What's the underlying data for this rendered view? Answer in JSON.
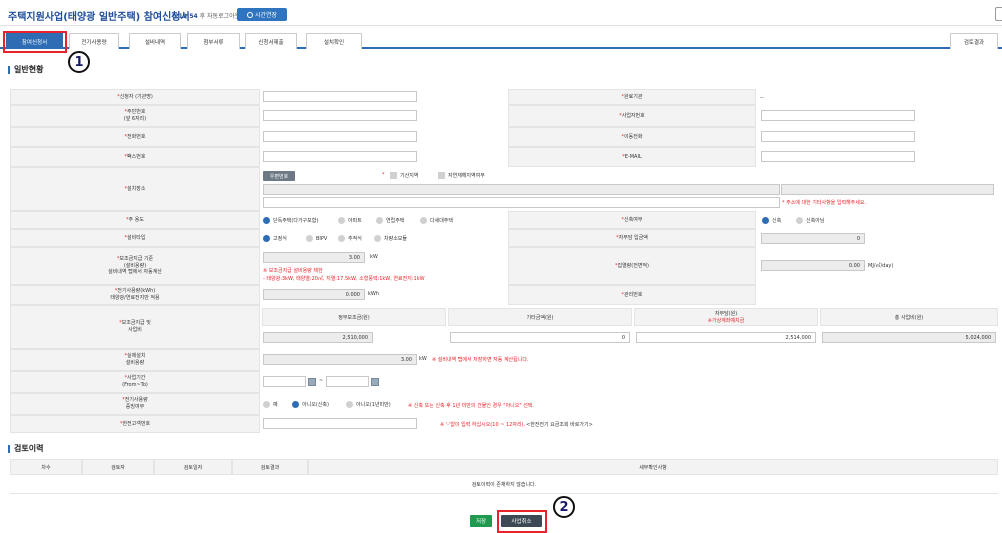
{
  "header": {
    "title": "주택지원사업(태양광 일반주택) 참여신청서",
    "timer_value": "0:19:54",
    "timer_suffix": "후 자동로그아웃",
    "extend_label": "시간연장"
  },
  "tabs": [
    {
      "label": "참여신청서",
      "active": true
    },
    {
      "label": "전기사용량"
    },
    {
      "label": "설비내역"
    },
    {
      "label": "첨부서류"
    },
    {
      "label": "신청서제출"
    },
    {
      "label": "설치확인"
    }
  ],
  "review_tab": "검토결과",
  "markers": {
    "one": "1",
    "two": "2"
  },
  "section_general": "일반현황",
  "section_history": "검토이력",
  "form": {
    "applicant_label": "신청자 (기관명)",
    "agency_label": "완료기관",
    "agency_value": "--",
    "id_label": "주민번호\n(앞 6자리)",
    "bizno_label": "사업자번호",
    "phone_label": "전화번호",
    "mobile_label": "이동전화",
    "fax_label": "팩스번호",
    "email_label": "E-MAIL",
    "address_label": "설치장소",
    "postcode_btn": "우편번호",
    "chk_a": "기산지역",
    "chk_b": "자연재해지역여부",
    "address_note": "* 주소에 대한 기타사항을 입력해주세요.",
    "use_label": "주 용도",
    "use_opts": [
      "단독주택(다가구포함)",
      "아파트",
      "연립주택",
      "다세대주택"
    ],
    "new_label": "신축여부",
    "new_opts": [
      "신축",
      "신축아님"
    ],
    "type_label": "설비타입",
    "type_opts": [
      "고정식",
      "BIPV",
      "추적식",
      "차량소모듈"
    ],
    "selfpay_label": "자부담 입금액",
    "selfpay_value": "0",
    "capacity_label": "보조금지급 기준\n(설비용량)\n설비내역 탭에서 자동계산",
    "capacity_value": "3.00",
    "capacity_unit": "kW",
    "capacity_note1": "※ 보조금지급 설비용량 제한",
    "capacity_note2": "- 태양광:3kW, 태양열:20㎡, 지열:17.5kW, 소형풍력:1kW, 연료전지:1kW",
    "irradiance_label": "집열량(전면적)",
    "irradiance_value": "0.00",
    "irradiance_unit": "MJ/㎡/day)",
    "usage_label": "전기사용량(kWh)\n태양광/연료전지만 적용",
    "usage_value": "0.000",
    "usage_unit": "kWh",
    "mgmt_label": "관리번호",
    "subsidy_label": "보조금지급 및\n사업비",
    "subsidy_headers": [
      "정부보조금(원)",
      "기타금액(원)",
      "자부담(원)",
      "총 사업비(원)"
    ],
    "subsidy_sub": "※가상계좌예치금",
    "subsidy_values": [
      "2,510,000",
      "0",
      "2,514,000",
      "5,024,000"
    ],
    "actual_label": "실제설치\n설비용량",
    "actual_value": "3.00",
    "actual_unit": "kW",
    "actual_note": "※ 설비내역 탭에서 저장하면 자동 계산됩니다.",
    "period_label": "사업기간\n(From~To)",
    "period_sep": "~",
    "cert_label": "전기사용량\n증빙여부",
    "cert_opts": [
      "예",
      "아니오(신축)",
      "아니오(1년미만)"
    ],
    "cert_note": "※ 신축 또는 신축 후 1년 미만의 건물인 경우 \"아니오\" 선택.",
    "kepco_label": "한전고객번호",
    "kepco_note": "※ '-'없이 입력 하십시오(10 ~ 12자리).",
    "kepco_link": "<한전전기 요금조회 바로가기>"
  },
  "history": {
    "headers": [
      "차수",
      "검토자",
      "검토일자",
      "검토결과",
      "세부확인사항"
    ],
    "empty": "검토이력이 존재하지 않습니다."
  },
  "buttons": {
    "save": "저장",
    "cancel": "사업취소"
  },
  "colors": {
    "primary": "#2e6db4",
    "highlight": "#e8232a",
    "save": "#1f9a4e",
    "cancel": "#3d4a55"
  }
}
